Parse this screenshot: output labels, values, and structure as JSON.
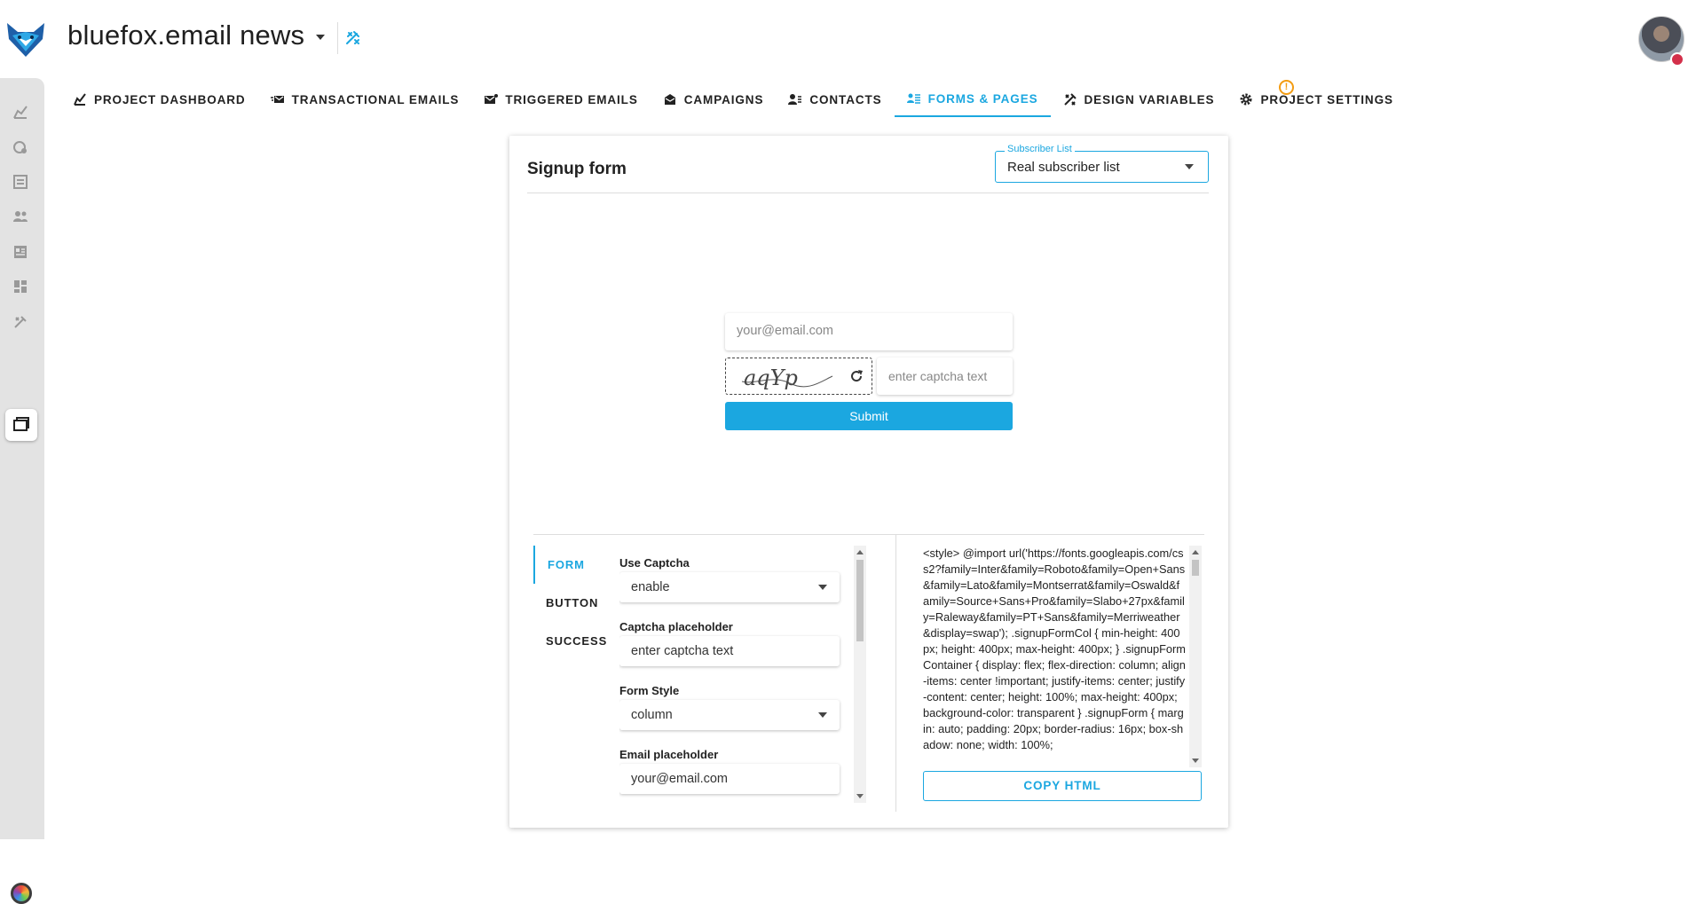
{
  "header": {
    "project_title": "bluefox.email news",
    "avatar_alt": "user avatar"
  },
  "tabs": [
    {
      "label": "PROJECT DASHBOARD",
      "icon": "chart-icon",
      "active": false
    },
    {
      "label": "TRANSACTIONAL EMAILS",
      "icon": "mail-fast-icon",
      "active": false
    },
    {
      "label": "TRIGGERED EMAILS",
      "icon": "mail-trigger-icon",
      "active": false
    },
    {
      "label": "CAMPAIGNS",
      "icon": "campaign-mail-icon",
      "active": false
    },
    {
      "label": "CONTACTS",
      "icon": "contacts-icon",
      "active": false
    },
    {
      "label": "FORMS & PAGES",
      "icon": "forms-icon",
      "active": true
    },
    {
      "label": "DESIGN VARIABLES",
      "icon": "design-tools-icon",
      "active": false
    },
    {
      "label": "PROJECT SETTINGS",
      "icon": "gear-icon",
      "active": false
    }
  ],
  "settings_warning": "!",
  "card": {
    "title": "Signup form",
    "subscriber_list": {
      "label": "Subscriber List",
      "value": "Real subscriber list"
    }
  },
  "preview": {
    "email_placeholder": "your@email.com",
    "captcha_text": "aqYp",
    "captcha_placeholder": "enter captcha text",
    "submit_label": "Submit"
  },
  "editor": {
    "sections": [
      {
        "label": "FORM",
        "active": true
      },
      {
        "label": "BUTTON",
        "active": false
      },
      {
        "label": "SUCCESS",
        "active": false
      }
    ],
    "fields": [
      {
        "label": "Use Captcha",
        "value": "enable",
        "type": "select"
      },
      {
        "label": "Captcha placeholder",
        "value": "enter captcha text",
        "type": "text"
      },
      {
        "label": "Form Style",
        "value": "column",
        "type": "select"
      },
      {
        "label": "Email placeholder",
        "value": "your@email.com",
        "type": "text"
      }
    ],
    "code": "<style> @import url('https://fonts.googleapis.com/css2?family=Inter&family=Roboto&family=Open+Sans&family=Lato&family=Montserrat&family=Oswald&family=Source+Sans+Pro&family=Slabo+27px&family=Raleway&family=PT+Sans&family=Merriweather&display=swap'); .signupFormCol { min-height: 400px; height: 400px; max-height: 400px; } .signupFormContainer { display: flex; flex-direction: column; align-items: center !important; justify-items: center; justify-content: center; height: 100%; max-height: 400px; background-color: transparent } .signupForm { margin: auto; padding: 20px; border-radius: 16px; box-shadow: none; width: 100%;",
    "copy_label": "COPY HTML"
  },
  "colors": {
    "accent": "#1ba7e0",
    "warning": "#f39c12"
  }
}
